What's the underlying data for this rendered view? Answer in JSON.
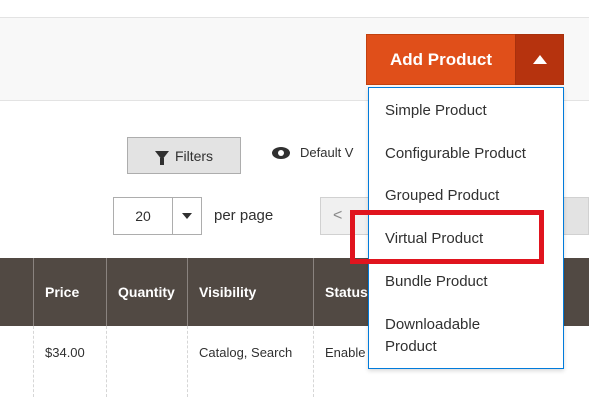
{
  "header": {
    "add_product_label": "Add Product"
  },
  "toolbar": {
    "filters_label": "Filters",
    "view_label": "Default V",
    "per_page_value": "20",
    "per_page_label": "per page",
    "pager_prev_glyph": "<"
  },
  "grid": {
    "columns": [
      "Price",
      "Quantity",
      "Visibility",
      "Status"
    ],
    "rows": [
      {
        "price": "$34.00",
        "quantity": "",
        "visibility": "Catalog, Search",
        "status": "Enable"
      }
    ]
  },
  "add_product_menu": {
    "items": [
      "Simple Product",
      "Configurable Product",
      "Grouped Product",
      "Virtual Product",
      "Bundle Product",
      "Downloadable Product"
    ],
    "highlighted_item": "Virtual Product"
  },
  "colors": {
    "accent": "#e04f1a",
    "accent_dark": "#b6330e",
    "table_header": "#514943",
    "highlight_border": "#e0141e",
    "menu_border": "#007bdb"
  }
}
